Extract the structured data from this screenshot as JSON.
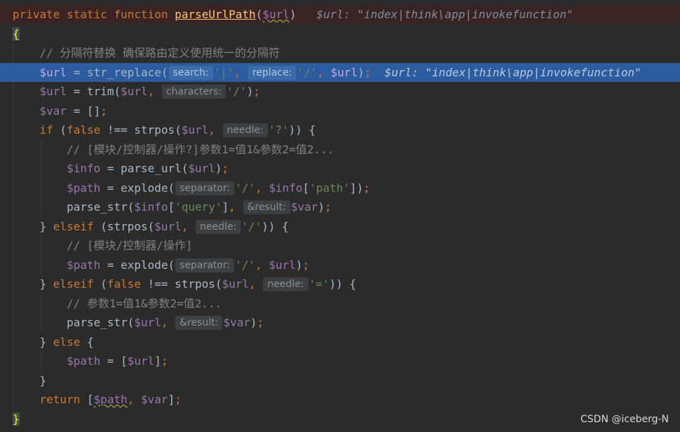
{
  "code": {
    "signature": {
      "kw_private": "private",
      "kw_static": "static",
      "kw_function": "function",
      "fn_name": "parseUrlPath",
      "param": "$url",
      "debug": "$url: \"index|think\\app|invokefunction\""
    },
    "open_brace": "{",
    "close_brace": "}",
    "comment_separator": "// 分隔符替换 确保路由定义使用统一的分隔符",
    "str_replace_line": {
      "var": "$url",
      "fn": "str_replace",
      "hint_search": "search:",
      "arg_search": "'|'",
      "hint_replace": "replace:",
      "arg_replace": "'/'",
      "arg_subject": "$url",
      "debug": "$url: \"index|think\\app|invokefunction\""
    },
    "trim_line": {
      "var": "$url",
      "fn": "trim",
      "arg1": "$url",
      "hint_characters": "characters:",
      "arg2": "'/'"
    },
    "var_init": {
      "var": "$var"
    },
    "if_line": {
      "kw_if": "if",
      "kw_false": "false",
      "fn": "strpos",
      "arg1": "$url",
      "hint_needle": "needle:",
      "arg2": "'?'"
    },
    "comment_module_query": "// [模块/控制器/操作?]参数1=值1&参数2=值2...",
    "parse_url_line": {
      "var": "$info",
      "fn": "parse_url",
      "arg": "$url"
    },
    "explode_path_line": {
      "var": "$path",
      "fn": "explode",
      "hint_separator": "separator:",
      "arg1": "'/'",
      "arg2_var": "$info",
      "arg2_key": "'path'"
    },
    "parse_str_query_line": {
      "fn": "parse_str",
      "arg1_var": "$info",
      "arg1_key": "'query'",
      "hint_result": "&result:",
      "arg2": "$var"
    },
    "elseif_slash_line": {
      "kw": "elseif",
      "fn": "strpos",
      "arg1": "$url",
      "hint_needle": "needle:",
      "arg2": "'/'"
    },
    "comment_module": "// [模块/控制器/操作]",
    "explode_url_line": {
      "var": "$path",
      "fn": "explode",
      "hint_separator": "separator:",
      "arg1": "'/'",
      "arg2": "$url"
    },
    "elseif_eq_line": {
      "kw": "elseif",
      "kw_false": "false",
      "fn": "strpos",
      "arg1": "$url",
      "hint_needle": "needle:",
      "arg2": "'='"
    },
    "comment_params": "// 参数1=值1&参数2=值2...",
    "parse_str_url_line": {
      "fn": "parse_str",
      "arg1": "$url",
      "hint_result": "&result:",
      "arg2": "$var"
    },
    "else_line": {
      "kw": "else"
    },
    "path_array_line": {
      "var": "$path",
      "item": "$url"
    },
    "return_line": {
      "kw": "return",
      "item1": "$path",
      "item2": "$var"
    }
  },
  "watermark": "CSDN @iceberg-N"
}
